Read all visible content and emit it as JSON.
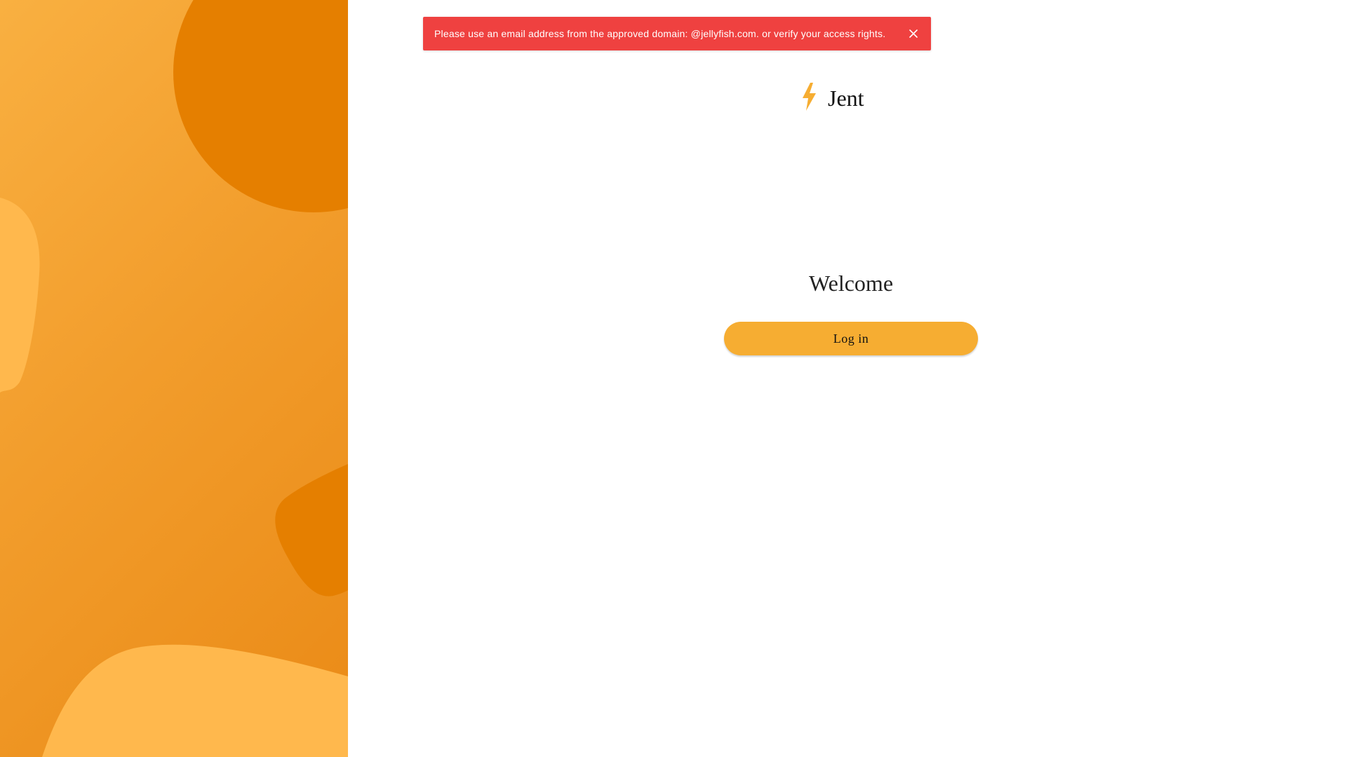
{
  "alert": {
    "message": "Please use an email address from the approved domain: @jellyfish.com. or verify your access rights.",
    "close_icon": "close-icon",
    "color": "#ef4140"
  },
  "brand": {
    "name": "Jent",
    "logo_icon": "lightning-bolt-icon",
    "accent_color": "#f6ad32"
  },
  "main": {
    "welcome_text": "Welcome",
    "login_label": "Log in"
  }
}
